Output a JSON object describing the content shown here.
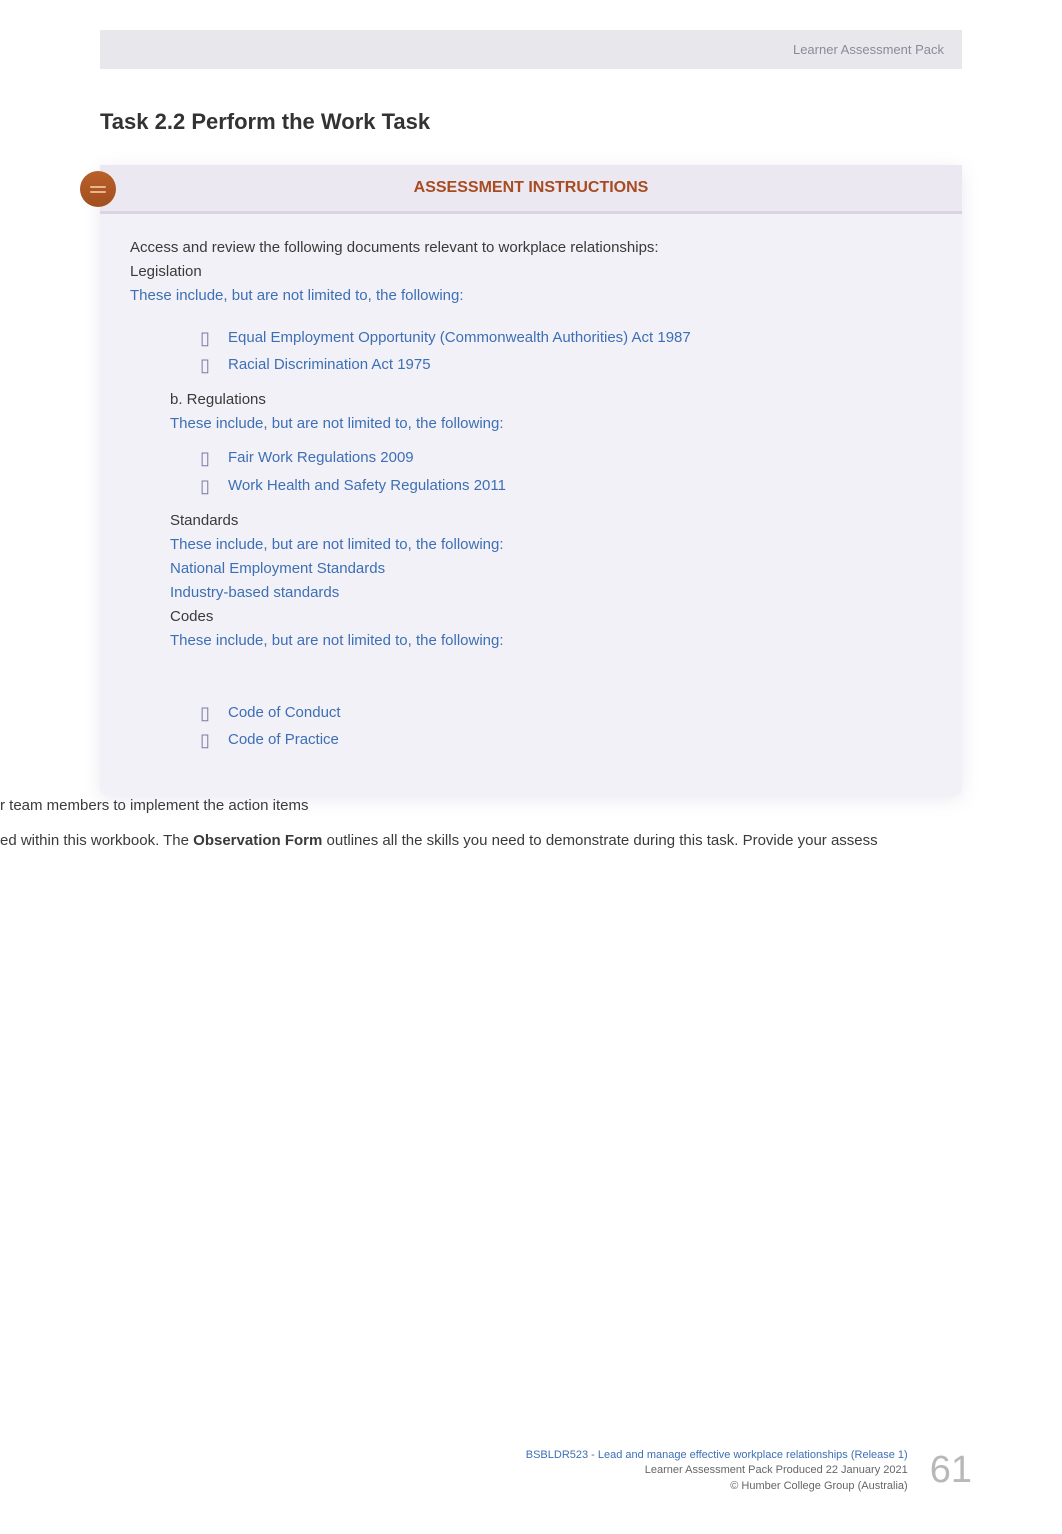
{
  "header": {
    "label": "Learner Assessment Pack"
  },
  "task_heading": "Task 2.2 Perform the Work Task",
  "assessment": {
    "title": "ASSESSMENT INSTRUCTIONS",
    "intro_line1": "Access and review the following documents relevant to workplace relationships:",
    "legislation_label": "Legislation",
    "these_include": "These include, but are not limited to, the following:",
    "bullets_a": [
      "Equal Employment Opportunity (Commonwealth Authorities) Act 1987",
      "Racial Discrimination Act 1975"
    ],
    "regulations_label": "b.   Regulations",
    "bullets_b": [
      "Fair Work Regulations 2009",
      "Work Health and Safety Regulations 2011"
    ],
    "standards_label": "Standards",
    "standards_lines": [
      "These include, but are not limited to, the following:",
      "National Employment Standards",
      "Industry-based standards"
    ],
    "codes_label": "Codes",
    "codes_include": "These include, but are not limited to, the following:",
    "bullets_codes": [
      "Code of Conduct",
      "Code of Practice"
    ]
  },
  "cut_text_1": "r  team  members  to  implement  the  action  items",
  "cut_text_2_prefix": "ed within this workbook. The ",
  "cut_text_2_bold": "Observation Form",
  "cut_text_2_suffix": " outlines all the skills you need to demonstrate during this task. Provide your assess",
  "footer": {
    "line1": "BSBLDR523 - Lead and manage effective workplace relationships (Release 1)",
    "line2": "Learner  Assessment  Pack  Produced  22  January  2021",
    "line3": "© Humber College Group (Australia)",
    "page_num": "61"
  }
}
